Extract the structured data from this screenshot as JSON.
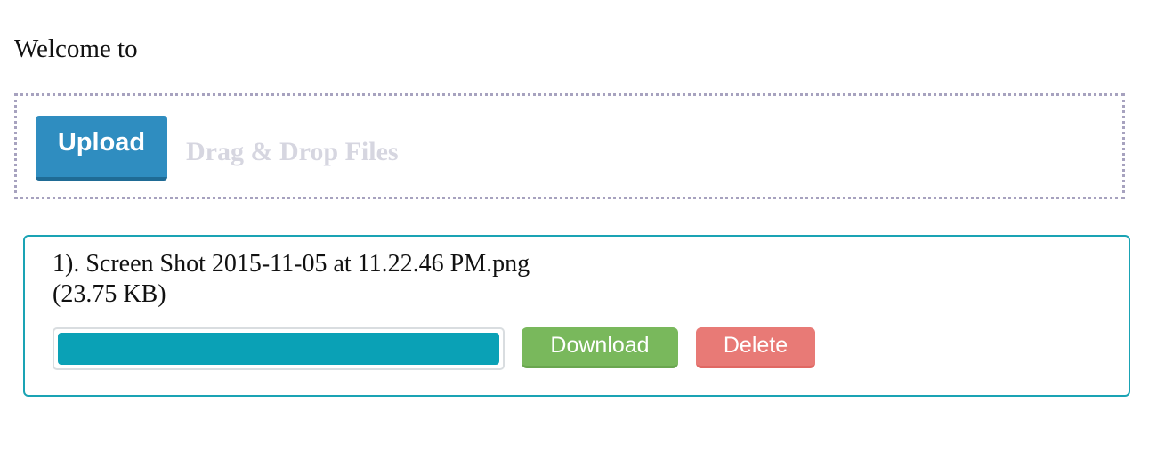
{
  "header": {
    "welcome": "Welcome to"
  },
  "dropzone": {
    "upload_label": "Upload",
    "drop_text": "Drag & Drop Files"
  },
  "files": [
    {
      "name": "1). Screen Shot 2015-11-05 at 11.22.46 PM.png (23.75 KB)",
      "progress_percent": 100,
      "download_label": "Download",
      "delete_label": "Delete"
    }
  ],
  "colors": {
    "upload": "#2f8dc0",
    "progress": "#0aa1b6",
    "download": "#79b85c",
    "delete": "#e87a76",
    "card_border": "#1aa3b4"
  }
}
